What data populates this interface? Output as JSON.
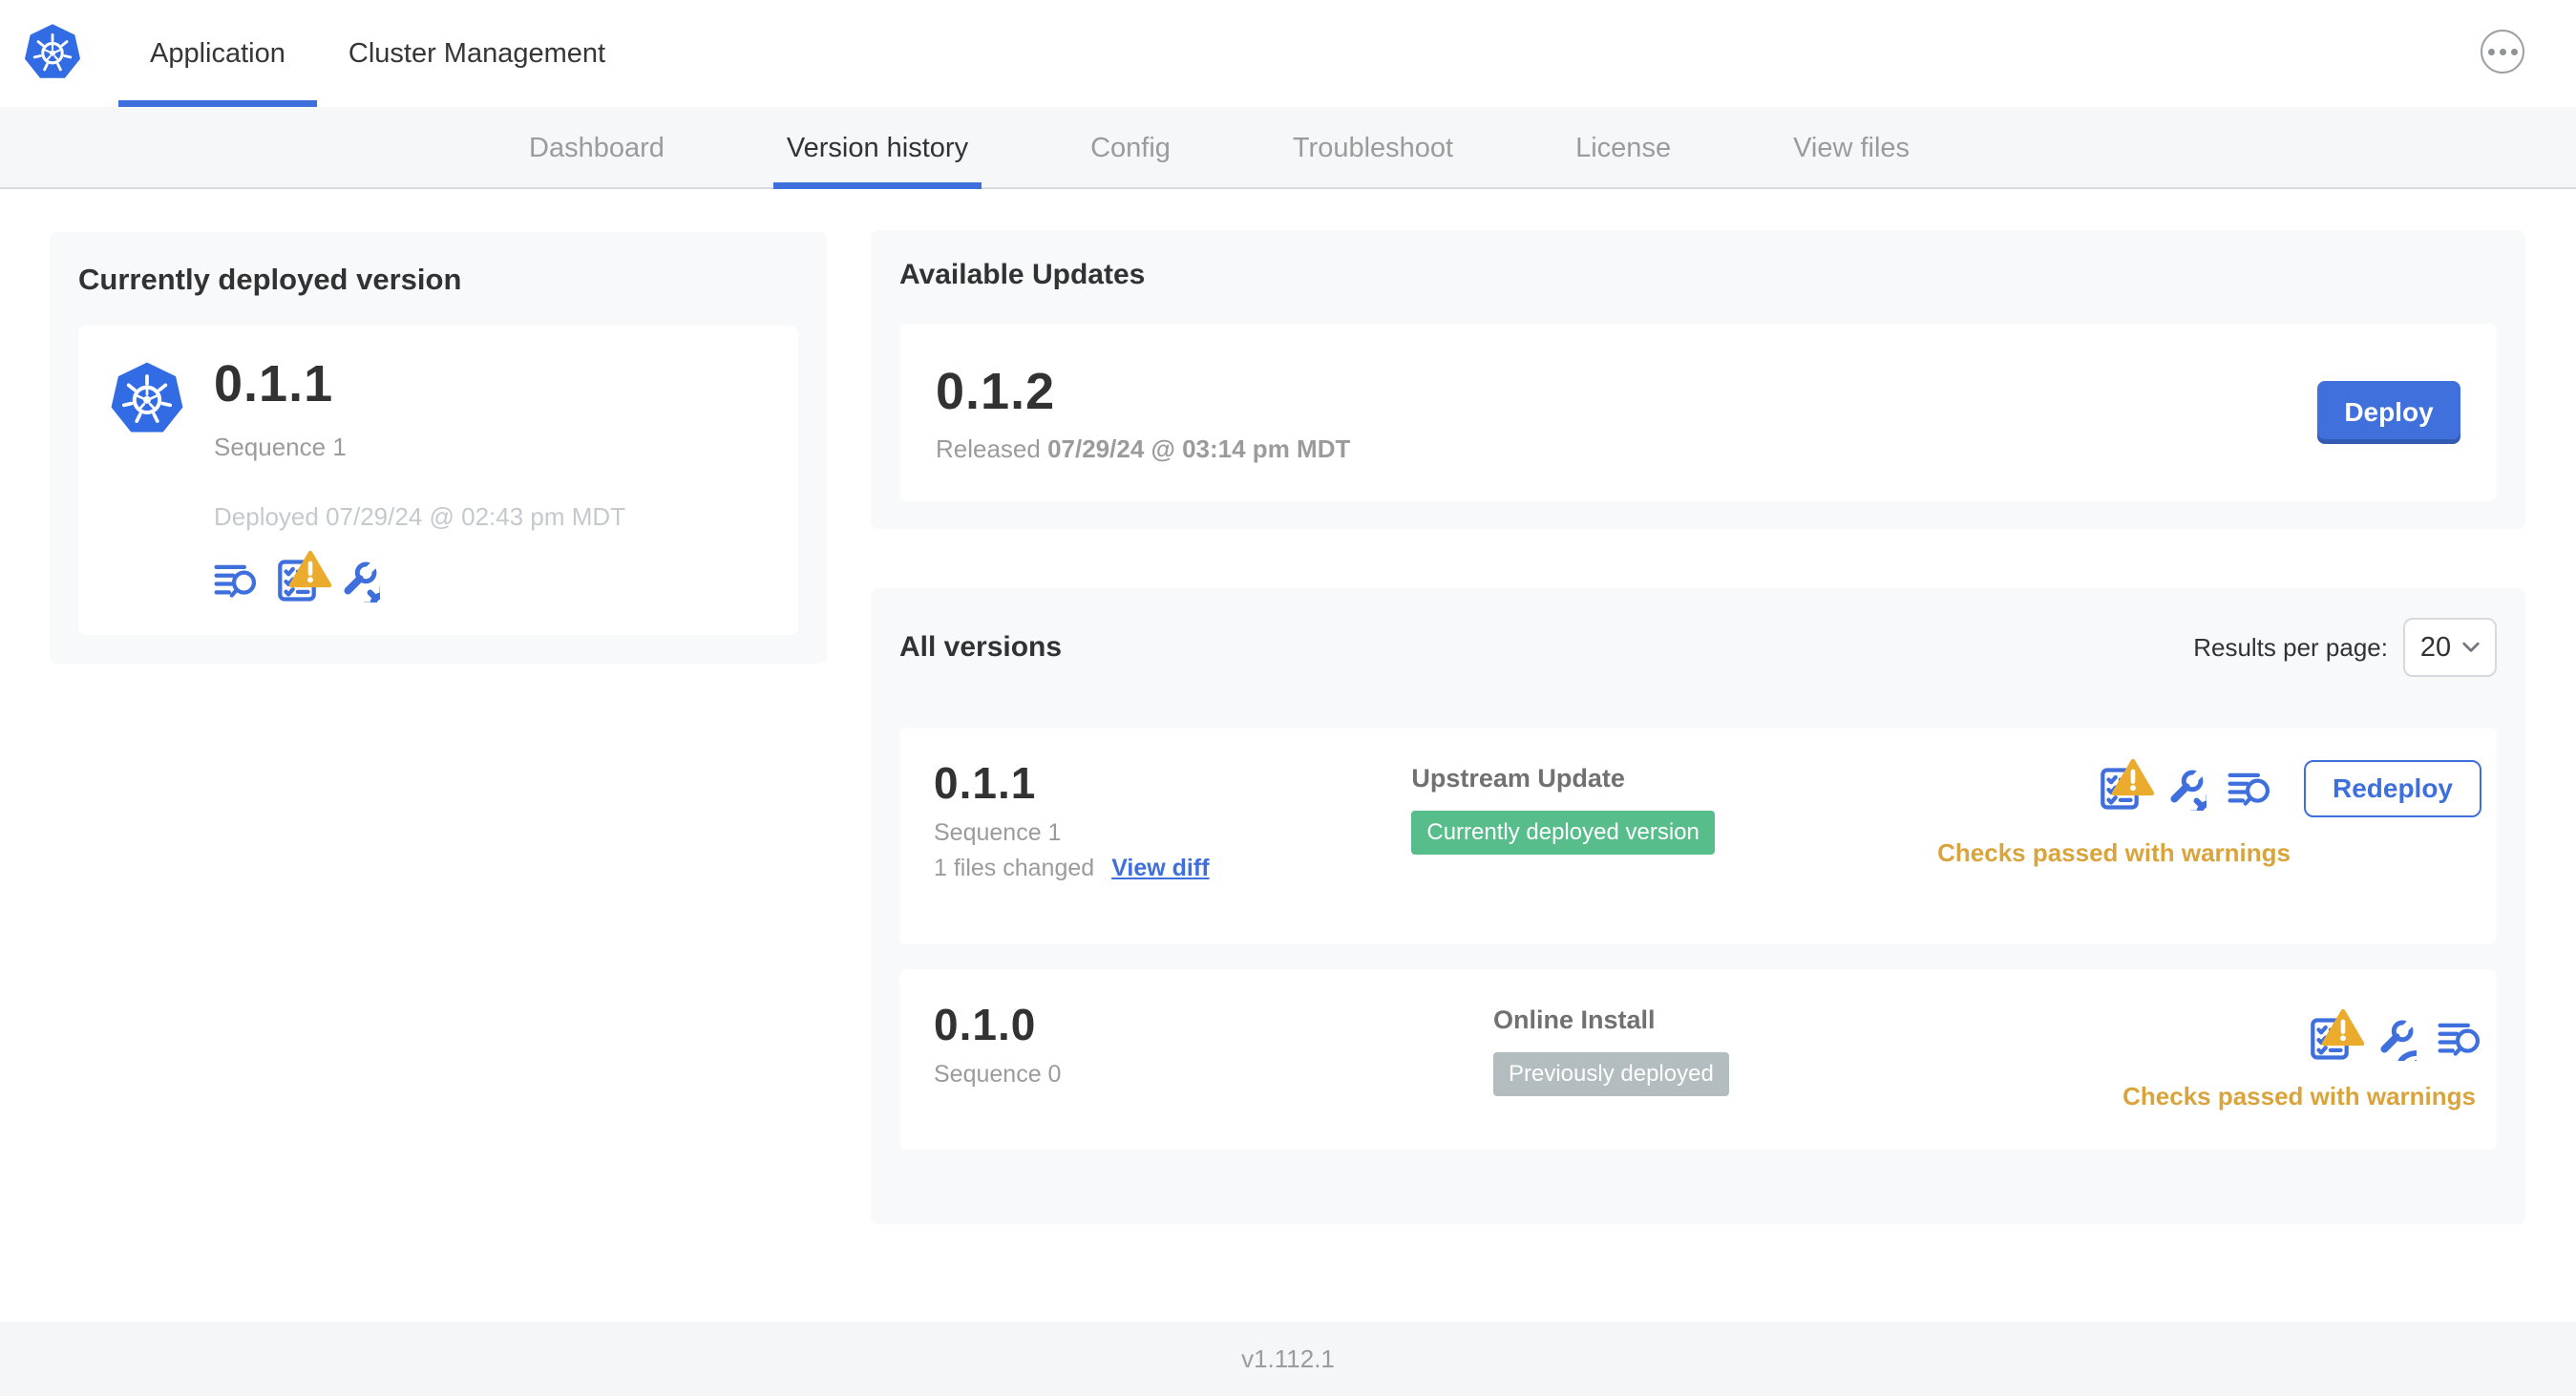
{
  "topnav": {
    "tabs": [
      {
        "label": "Application"
      },
      {
        "label": "Cluster Management"
      }
    ],
    "menu_icon": "ellipsis-menu-icon",
    "logo_icon": "kubernetes-logo"
  },
  "subnav": {
    "tabs": [
      "Dashboard",
      "Version history",
      "Config",
      "Troubleshoot",
      "License",
      "View files"
    ]
  },
  "deployed_card": {
    "title": "Currently deployed version",
    "version": "0.1.1",
    "sequence": "Sequence 1",
    "deployed_at": "Deployed 07/29/24 @ 02:43 pm MDT",
    "icons": [
      "view-logs-icon",
      "preflight-checks-warning-icon",
      "edit-config-icon"
    ]
  },
  "available_updates": {
    "title": "Available Updates",
    "version": "0.1.2",
    "released_prefix": "Released ",
    "released_date": "07/29/24 @ 03:14 pm MDT",
    "deploy_label": "Deploy"
  },
  "all_versions": {
    "title": "All versions",
    "results_per_page_label": "Results per page:",
    "results_per_page_value": "20",
    "rows": [
      {
        "version": "0.1.1",
        "sequence": "Sequence 1",
        "files_changed": "1 files changed",
        "view_diff_label": "View diff",
        "source": "Upstream Update",
        "badge": "Currently deployed version",
        "badge_style": "green",
        "status": "Checks passed with warnings",
        "action_label": "Redeploy",
        "icons": [
          "preflight-checks-warning-icon",
          "edit-config-icon",
          "view-logs-icon"
        ]
      },
      {
        "version": "0.1.0",
        "sequence": "Sequence 0",
        "source": "Online Install",
        "badge": "Previously deployed",
        "badge_style": "gray",
        "status": "Checks passed with warnings",
        "icons": [
          "preflight-checks-warning-icon",
          "view-config-icon",
          "view-logs-icon"
        ]
      }
    ]
  },
  "footer": {
    "app_version": "v1.112.1"
  },
  "colors": {
    "kubernetes_blue": "#326CE5",
    "primary_blue": "#3E6FDC",
    "deployed_badge_green": "#56BD8B",
    "previous_badge_gray": "#B3BCBE",
    "warning_amber_text": "#D9A43B",
    "warning_triangle": "#EBAB2D",
    "subnav_background": "#F6F7F9",
    "card_background": "#F8F9FA"
  }
}
